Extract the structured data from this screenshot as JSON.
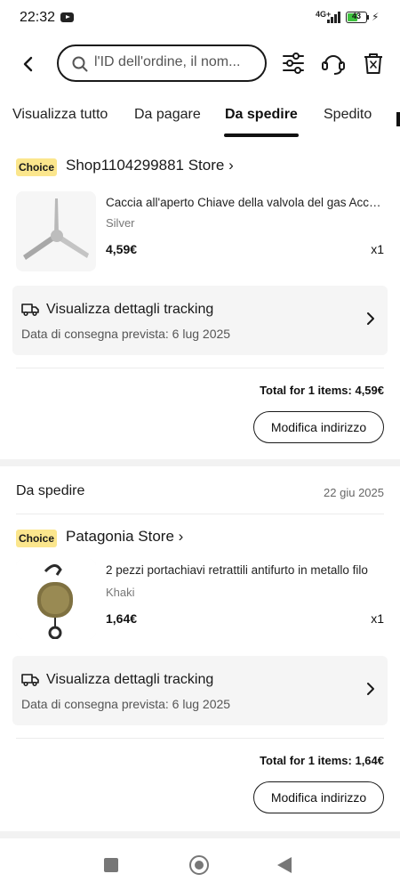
{
  "status_bar": {
    "time": "22:32",
    "network": "4G+",
    "battery": "43",
    "icons": [
      "youtube-icon",
      "signal-icon",
      "battery-icon",
      "charging-icon"
    ]
  },
  "topbar": {
    "search_placeholder": "l'ID dell'ordine, il nom...",
    "icons": [
      "back-icon",
      "search-icon",
      "filter-icon",
      "support-icon",
      "trash-icon"
    ]
  },
  "tabs": [
    {
      "label": "Visualizza tutto",
      "active": false
    },
    {
      "label": "Da pagare",
      "active": false
    },
    {
      "label": "Da spedire",
      "active": true
    },
    {
      "label": "Spedito",
      "active": false
    }
  ],
  "orders": [
    {
      "status": "",
      "date": "",
      "badge": "Choice",
      "store": "Shop1104299881 Store",
      "product": {
        "title": "Caccia all'aperto Chiave della valvola del gas Accessori",
        "variant": "Silver",
        "price": "4,59€",
        "qty": "x1"
      },
      "tracking": {
        "title": "Visualizza dettagli tracking",
        "date": "Data di consegna prevista: 6 lug 2025"
      },
      "total": "Total for 1 items: 4,59€",
      "button": "Modifica indirizzo"
    },
    {
      "status": "Da spedire",
      "date": "22 giu 2025",
      "badge": "Choice",
      "store": "Patagonia Store",
      "product": {
        "title": "2 pezzi portachiavi retrattili antifurto in metallo filo",
        "variant": "Khaki",
        "price": "1,64€",
        "qty": "x1"
      },
      "tracking": {
        "title": "Visualizza dettagli tracking",
        "date": "Data di consegna prevista: 6 lug 2025"
      },
      "total": "Total for 1 items: 1,64€",
      "button": "Modifica indirizzo"
    }
  ],
  "colors": {
    "choice_badge": "#fbe68d",
    "text_primary": "#191919",
    "card_background": "#f5f5f5",
    "active_tab_underline": "#111111"
  }
}
